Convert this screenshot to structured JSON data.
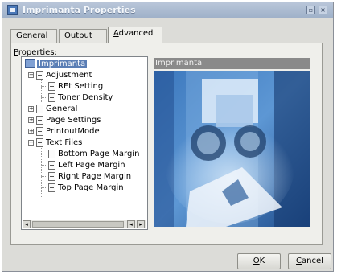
{
  "window": {
    "title": "Imprimanta Properties",
    "close_glyph": "×",
    "menu_glyph": "▫"
  },
  "tabs": [
    {
      "label": "General",
      "accel": "G",
      "rest": "eneral"
    },
    {
      "label": "Output",
      "accel": "u",
      "pre": "O",
      "rest": "tput"
    },
    {
      "label": "Advanced",
      "accel": "A",
      "rest": "dvanced"
    }
  ],
  "properties_label": "Properties:",
  "properties_accel": "P",
  "properties_rest": "roperties:",
  "tree": [
    {
      "label": "Imprimanta",
      "level": 0,
      "icon": "printer-icon",
      "selected": true
    },
    {
      "label": "Adjustment",
      "level": 1,
      "expander": "−"
    },
    {
      "label": "REt Setting",
      "level": 2
    },
    {
      "label": "Toner Density",
      "level": 2
    },
    {
      "label": "General",
      "level": 1,
      "expander": "+"
    },
    {
      "label": "Page Settings",
      "level": 1,
      "expander": "+"
    },
    {
      "label": "PrintoutMode",
      "level": 1,
      "expander": "+"
    },
    {
      "label": "Text Files",
      "level": 1,
      "expander": "−"
    },
    {
      "label": "Bottom Page Margin",
      "level": 2
    },
    {
      "label": "Left Page Margin",
      "level": 2
    },
    {
      "label": "Right Page Margin",
      "level": 2
    },
    {
      "label": "Top Page Margin",
      "level": 2
    }
  ],
  "preview": {
    "header": "Imprimanta"
  },
  "buttons": {
    "ok": {
      "accel": "O",
      "rest": "K"
    },
    "cancel": {
      "accel": "C",
      "rest": "ancel"
    }
  },
  "scroll_glyphs": {
    "left": "◂",
    "right": "▸",
    "left_end": "◂"
  }
}
